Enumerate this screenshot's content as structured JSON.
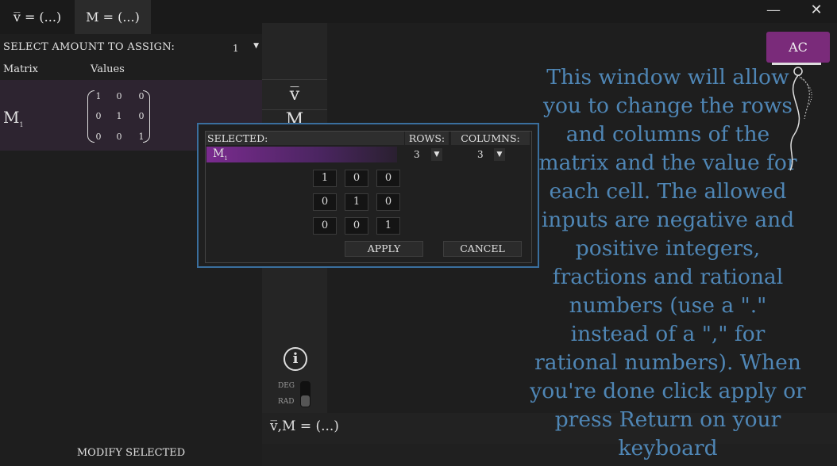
{
  "tabs": [
    {
      "label": "v̅ = (...)"
    },
    {
      "label": "M = (...)"
    }
  ],
  "window": {
    "minimize": "—",
    "close": "✕"
  },
  "left_panel": {
    "assign_label": "SELECT AMOUNT TO ASSIGN:",
    "assign_value": "1",
    "col_matrix": "Matrix",
    "col_values": "Values",
    "row": {
      "name": "M",
      "subscript": "1",
      "values": [
        [
          "1",
          "0",
          "0"
        ],
        [
          "0",
          "1",
          "0"
        ],
        [
          "0",
          "0",
          "1"
        ]
      ]
    },
    "modify_button": "MODIFY SELECTED"
  },
  "middle": {
    "vector_button": "v̅",
    "matrix_button": "M",
    "info_icon": "i",
    "deg_label": "DEG",
    "rad_label": "RAD"
  },
  "expression": "v̅,M = (...)",
  "ac_button": "AC",
  "help_text": "This window will allow you to change the rows and columns of the matrix and the value for each cell. The allowed inputs are negative and positive integers, fractions and rational numbers (use a \".\" instead of a \",\" for rational numbers). When you're done click apply or press Return on your keyboard",
  "dialog": {
    "selected_label": "SELECTED:",
    "rows_label": "ROWS:",
    "columns_label": "COLUMNS:",
    "selected_name": "M",
    "selected_sub": "1",
    "rows_value": "3",
    "columns_value": "3",
    "cells": [
      [
        "1",
        "0",
        "0"
      ],
      [
        "0",
        "1",
        "0"
      ],
      [
        "0",
        "0",
        "1"
      ]
    ],
    "apply": "APPLY",
    "cancel": "CANCEL"
  },
  "colors": {
    "accent_purple": "#7a2b7a",
    "help_blue": "#4f86b5",
    "dialog_border": "#3a6f9e"
  }
}
